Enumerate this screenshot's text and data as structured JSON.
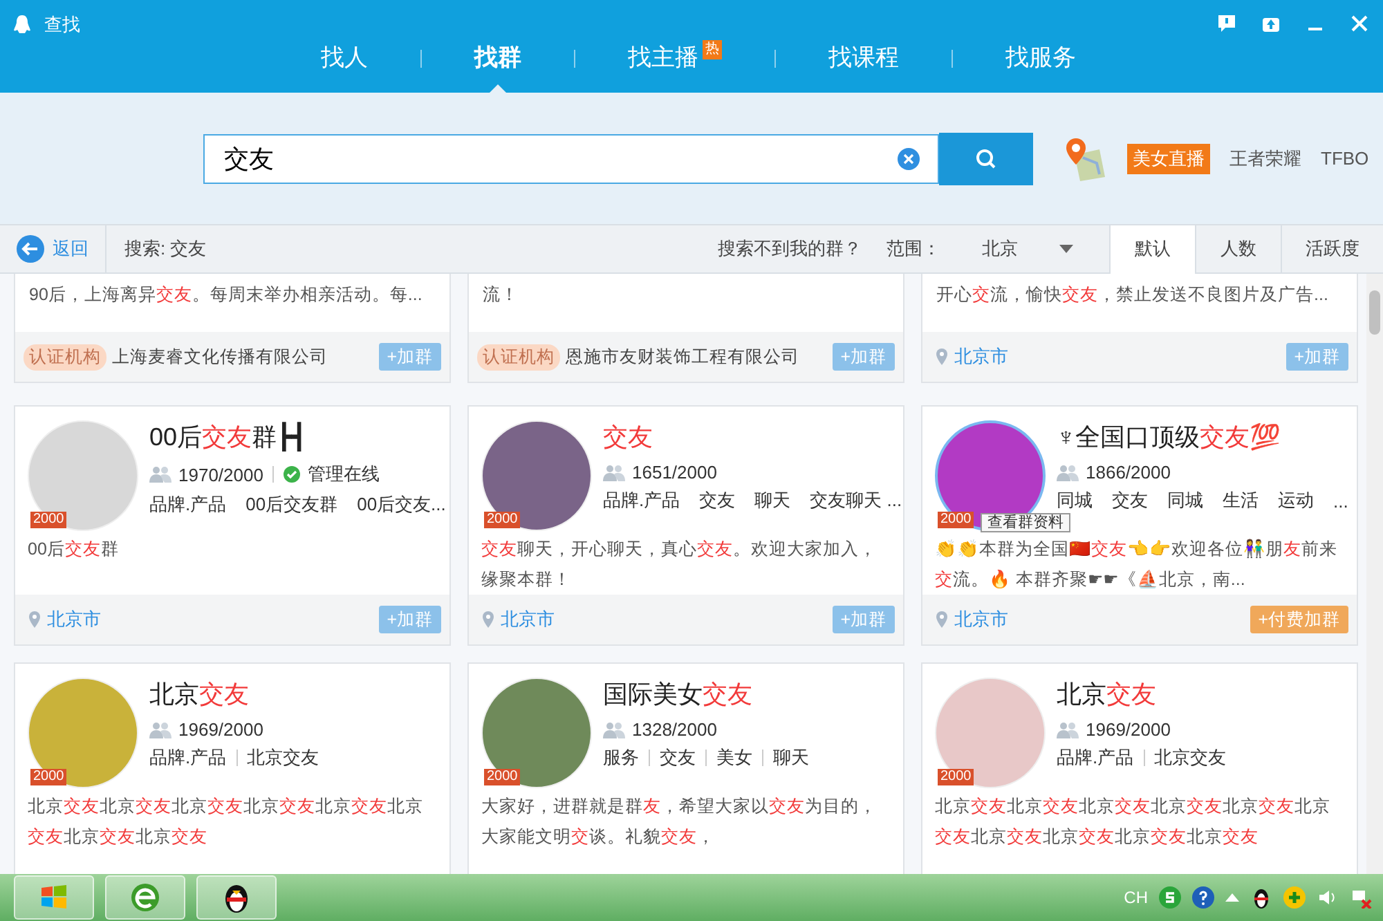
{
  "window": {
    "title": "查找"
  },
  "nav_tabs": [
    {
      "label": "找人",
      "selected": false
    },
    {
      "label": "找群",
      "selected": true
    },
    {
      "label": "找主播",
      "selected": false,
      "badge": "热"
    },
    {
      "label": "找课程",
      "selected": false
    },
    {
      "label": "找服务",
      "selected": false
    }
  ],
  "search": {
    "value": "交友"
  },
  "promo_links": [
    {
      "label": "美女直播",
      "kind": "badge"
    },
    {
      "label": "王者荣耀",
      "kind": "link"
    },
    {
      "label": "TFBO",
      "kind": "link"
    }
  ],
  "filter_bar": {
    "back": "返回",
    "query": "搜索: 交友",
    "help_link": "搜索不到我的群？",
    "scope_label": "范围：",
    "scope_value": "北京",
    "sort_tabs": [
      {
        "label": "默认",
        "selected": true
      },
      {
        "label": "人数",
        "selected": false
      },
      {
        "label": "活跃度",
        "selected": false
      }
    ]
  },
  "partial_cards": [
    {
      "description": [
        {
          "text": "90后，上海离异",
          "highlight": false
        },
        {
          "text": "交友",
          "highlight": true
        },
        {
          "text": "。每周末举办相亲活动。每...",
          "highlight": false
        }
      ],
      "footer": {
        "kind": "certified",
        "badge": "认证机构",
        "text": "上海麦睿文化传播有限公司"
      },
      "join_button": {
        "label": "+加群",
        "kind": "free"
      }
    },
    {
      "description": [
        {
          "text": "流！",
          "highlight": false
        }
      ],
      "footer": {
        "kind": "certified",
        "badge": "认证机构",
        "text": "恩施市友财装饰工程有限公司"
      },
      "join_button": {
        "label": "+加群",
        "kind": "free"
      }
    },
    {
      "description": [
        {
          "text": "开心",
          "highlight": false
        },
        {
          "text": "交",
          "highlight": true
        },
        {
          "text": "流，愉快",
          "highlight": false
        },
        {
          "text": "交友",
          "highlight": true
        },
        {
          "text": "，禁止发送不良图片及广告...",
          "highlight": false
        }
      ],
      "footer": {
        "kind": "location",
        "text": "北京市"
      },
      "join_button": {
        "label": "+加群",
        "kind": "free"
      }
    }
  ],
  "cards": [
    {
      "title": [
        {
          "text": "00后",
          "highlight": false
        },
        {
          "text": "交友",
          "highlight": true
        },
        {
          "text": "群┣┫",
          "highlight": false
        }
      ],
      "avatar_badge": "2000",
      "avatar_hovered": false,
      "members": "1970/2000",
      "admin_status": "管理在线",
      "tags": [
        "品牌.产品",
        "00后交友群",
        "00后交友..."
      ],
      "description": [
        {
          "text": "00后",
          "highlight": false
        },
        {
          "text": "交友",
          "highlight": true
        },
        {
          "text": "群",
          "highlight": false
        }
      ],
      "footer": {
        "kind": "location",
        "text": "北京市"
      },
      "join_button": {
        "label": "+加群",
        "kind": "free"
      }
    },
    {
      "title": [
        {
          "text": "交友",
          "highlight": true
        }
      ],
      "avatar_badge": "2000",
      "avatar_hovered": false,
      "members": "1651/2000",
      "tags": [
        "品牌.产品",
        "交友",
        "聊天",
        "交友聊天 ..."
      ],
      "description": [
        {
          "text": "交友",
          "highlight": true
        },
        {
          "text": "聊天，开心聊天，真心",
          "highlight": false
        },
        {
          "text": "交友",
          "highlight": true
        },
        {
          "text": "。欢迎大家加入，缘聚本群！",
          "highlight": false
        }
      ],
      "footer": {
        "kind": "location",
        "text": "北京市"
      },
      "join_button": {
        "label": "+加群",
        "kind": "free"
      }
    },
    {
      "title": [
        {
          "text": "♆全国口顶级",
          "highlight": false
        },
        {
          "text": "交友",
          "highlight": true
        }
      ],
      "title_emoji": "💯",
      "avatar_badge": "2000",
      "avatar_hovered": true,
      "tooltip": "查看群资料",
      "members": "1866/2000",
      "tags": [
        "同城",
        "交友",
        "同城",
        "生活",
        "运动",
        "..."
      ],
      "description": [
        {
          "text": "👏👏本群为全国🇨🇳",
          "highlight": false
        },
        {
          "text": "交友",
          "highlight": true
        },
        {
          "text": "👈👉欢迎各位👫朋",
          "highlight": false
        },
        {
          "text": "友",
          "highlight": true
        },
        {
          "text": "前来",
          "highlight": false
        },
        {
          "text": "交",
          "highlight": true
        },
        {
          "text": "流。🔥 本群齐聚☛☛《⛵北京，南...",
          "highlight": false
        }
      ],
      "footer": {
        "kind": "location",
        "text": "北京市"
      },
      "join_button": {
        "label": "+付费加群",
        "kind": "paid"
      }
    },
    {
      "title": [
        {
          "text": "北京",
          "highlight": false
        },
        {
          "text": "交友",
          "highlight": true
        }
      ],
      "avatar_badge": "2000",
      "avatar_hovered": false,
      "members": "1969/2000",
      "tags": [
        "品牌.产品",
        "北京交友"
      ],
      "description": [
        {
          "text": "北京",
          "highlight": false
        },
        {
          "text": "交友",
          "highlight": true
        },
        {
          "text": "北京",
          "highlight": false
        },
        {
          "text": "交友",
          "highlight": true
        },
        {
          "text": "北京",
          "highlight": false
        },
        {
          "text": "交友",
          "highlight": true
        },
        {
          "text": "北京",
          "highlight": false
        },
        {
          "text": "交友",
          "highlight": true
        },
        {
          "text": "北京",
          "highlight": false
        },
        {
          "text": "交友",
          "highlight": true
        },
        {
          "text": "北京",
          "highlight": false
        },
        {
          "text": "交友",
          "highlight": true
        },
        {
          "text": "北京",
          "highlight": false
        },
        {
          "text": "交友",
          "highlight": true
        },
        {
          "text": "北京",
          "highlight": false
        },
        {
          "text": "交友",
          "highlight": true
        }
      ]
    },
    {
      "title": [
        {
          "text": "国际美女",
          "highlight": false
        },
        {
          "text": "交友",
          "highlight": true
        }
      ],
      "avatar_badge": "2000",
      "avatar_hovered": false,
      "members": "1328/2000",
      "tags": [
        "服务",
        "交友",
        "美女",
        "聊天"
      ],
      "description": [
        {
          "text": "大家好，进群就是群",
          "highlight": false
        },
        {
          "text": "友",
          "highlight": true
        },
        {
          "text": "，希望大家以",
          "highlight": false
        },
        {
          "text": "交友",
          "highlight": true
        },
        {
          "text": "为目的，大家能文明",
          "highlight": false
        },
        {
          "text": "交",
          "highlight": true
        },
        {
          "text": "谈。礼貌",
          "highlight": false
        },
        {
          "text": "交友",
          "highlight": true
        },
        {
          "text": "，",
          "highlight": false
        }
      ]
    },
    {
      "title": [
        {
          "text": "北京",
          "highlight": false
        },
        {
          "text": "交友",
          "highlight": true
        }
      ],
      "avatar_badge": "2000",
      "avatar_hovered": false,
      "members": "1969/2000",
      "tags": [
        "品牌.产品",
        "北京交友"
      ],
      "description": [
        {
          "text": "北京",
          "highlight": false
        },
        {
          "text": "交友",
          "highlight": true
        },
        {
          "text": "北京",
          "highlight": false
        },
        {
          "text": "交友",
          "highlight": true
        },
        {
          "text": "北京",
          "highlight": false
        },
        {
          "text": "交友",
          "highlight": true
        },
        {
          "text": "北京",
          "highlight": false
        },
        {
          "text": "交友",
          "highlight": true
        },
        {
          "text": "北京",
          "highlight": false
        },
        {
          "text": "交友",
          "highlight": true
        },
        {
          "text": "北京",
          "highlight": false
        },
        {
          "text": "交友",
          "highlight": true
        },
        {
          "text": "北京",
          "highlight": false
        },
        {
          "text": "交友",
          "highlight": true
        },
        {
          "text": "北京",
          "highlight": false
        },
        {
          "text": "交友",
          "highlight": true
        },
        {
          "text": "北京",
          "highlight": false
        },
        {
          "text": "交友",
          "highlight": true
        },
        {
          "text": "北京",
          "highlight": false
        },
        {
          "text": "交友",
          "highlight": true
        }
      ]
    }
  ],
  "taskbar": {
    "language": "CH"
  }
}
